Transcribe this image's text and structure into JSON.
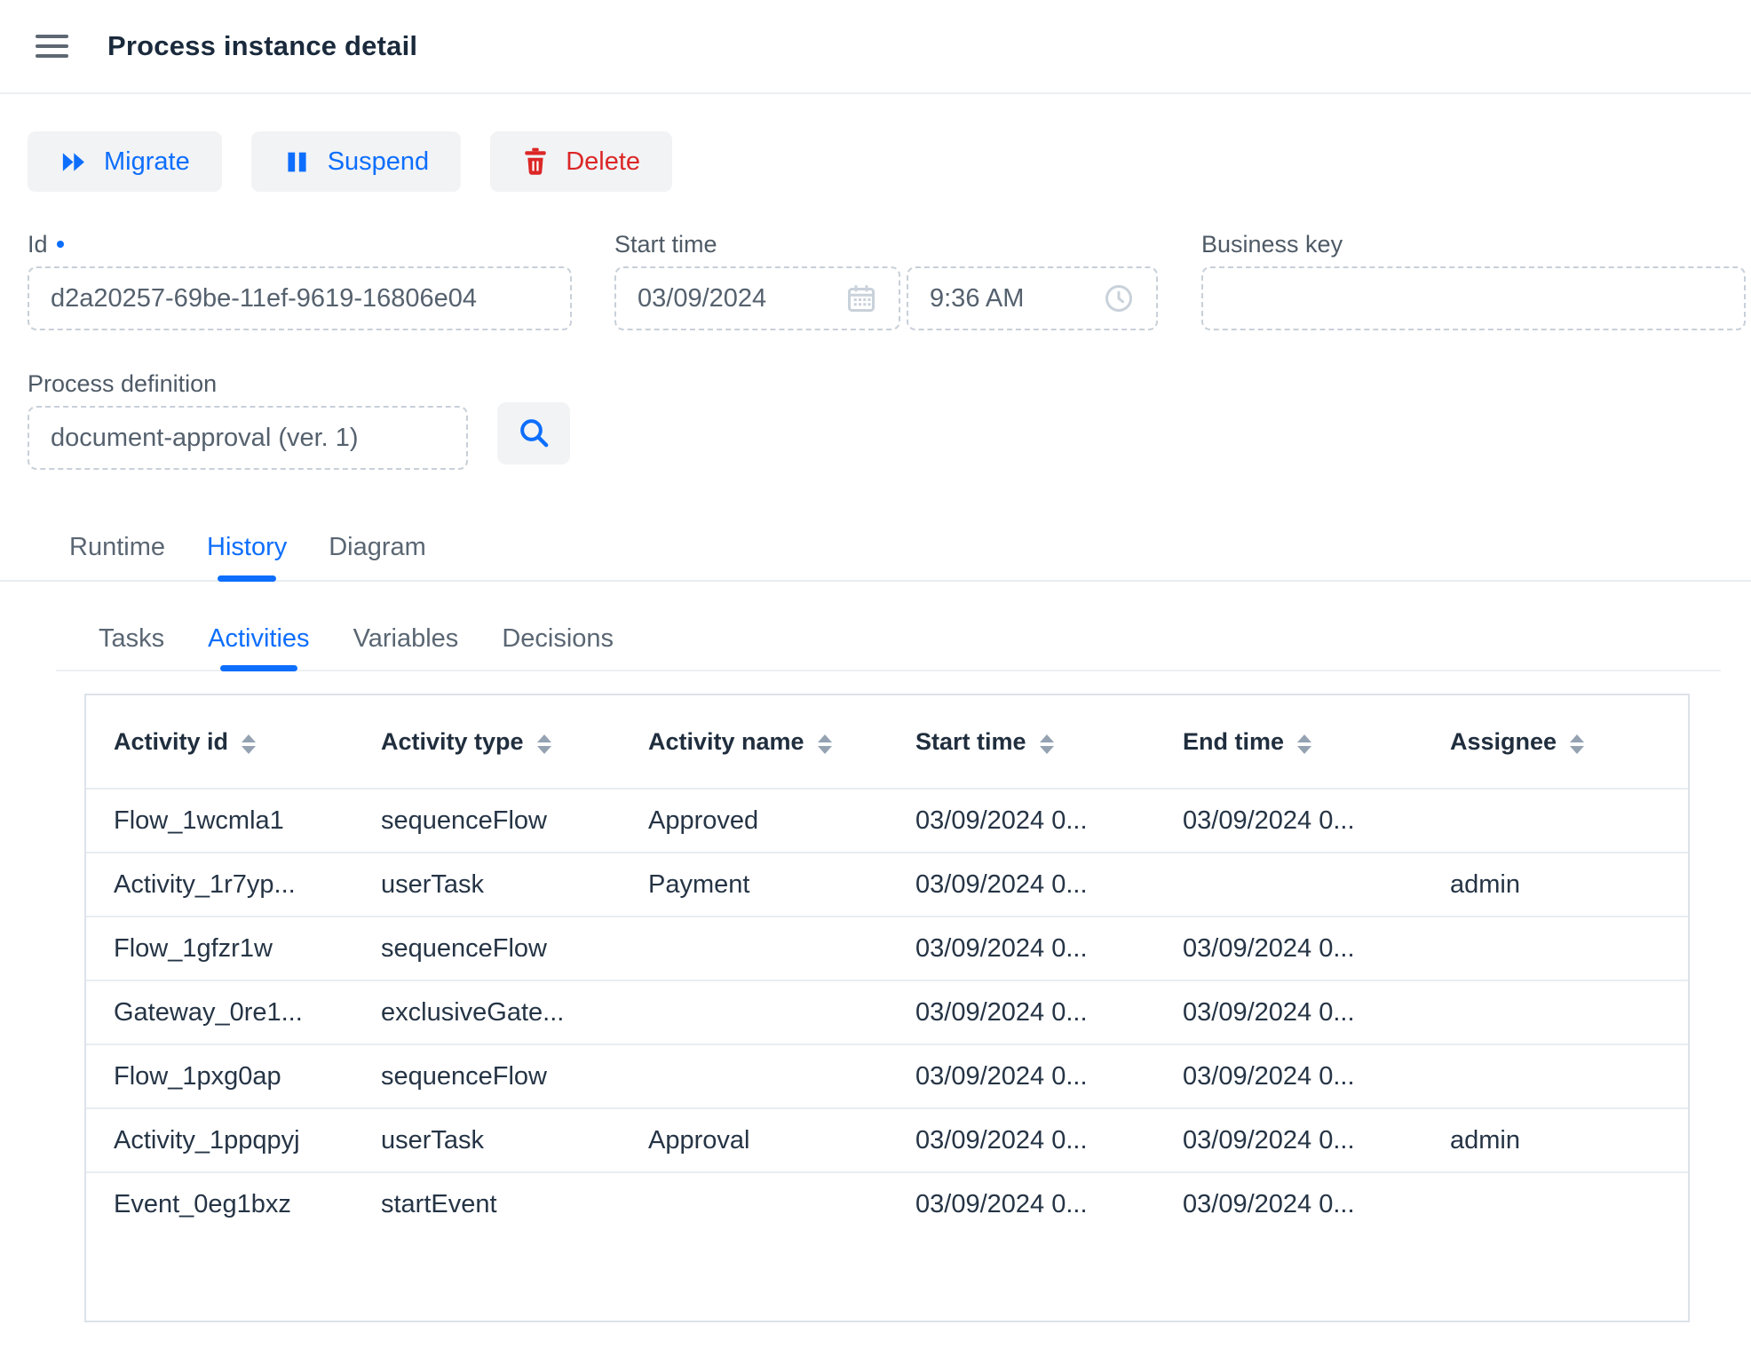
{
  "header": {
    "title": "Process instance detail"
  },
  "actions": {
    "migrate_label": "Migrate",
    "suspend_label": "Suspend",
    "delete_label": "Delete"
  },
  "form": {
    "id": {
      "label": "Id",
      "value": "d2a20257-69be-11ef-9619-16806e04"
    },
    "start_time": {
      "label": "Start time",
      "date_value": "03/09/2024",
      "time_value": "9:36 AM"
    },
    "business_key": {
      "label": "Business key",
      "value": ""
    },
    "process_definition": {
      "label": "Process definition",
      "value": "document-approval (ver. 1)"
    }
  },
  "tabs": {
    "items": [
      {
        "label": "Runtime",
        "active": false
      },
      {
        "label": "History",
        "active": true
      },
      {
        "label": "Diagram",
        "active": false
      }
    ]
  },
  "subtabs": {
    "items": [
      {
        "label": "Tasks",
        "active": false
      },
      {
        "label": "Activities",
        "active": true
      },
      {
        "label": "Variables",
        "active": false
      },
      {
        "label": "Decisions",
        "active": false
      }
    ]
  },
  "table": {
    "columns": [
      {
        "label": "Activity id"
      },
      {
        "label": "Activity type"
      },
      {
        "label": "Activity name"
      },
      {
        "label": "Start time"
      },
      {
        "label": "End time"
      },
      {
        "label": "Assignee"
      }
    ],
    "rows": [
      {
        "activity_id": "Flow_1wcmla1",
        "activity_type": "sequenceFlow",
        "activity_name": "Approved",
        "start_time": "03/09/2024 0...",
        "end_time": "03/09/2024 0...",
        "assignee": ""
      },
      {
        "activity_id": "Activity_1r7yp...",
        "activity_type": "userTask",
        "activity_name": "Payment",
        "start_time": "03/09/2024 0...",
        "end_time": "",
        "assignee": "admin"
      },
      {
        "activity_id": "Flow_1gfzr1w",
        "activity_type": "sequenceFlow",
        "activity_name": "",
        "start_time": "03/09/2024 0...",
        "end_time": "03/09/2024 0...",
        "assignee": ""
      },
      {
        "activity_id": "Gateway_0re1...",
        "activity_type": "exclusiveGate...",
        "activity_name": "",
        "start_time": "03/09/2024 0...",
        "end_time": "03/09/2024 0...",
        "assignee": ""
      },
      {
        "activity_id": "Flow_1pxg0ap",
        "activity_type": "sequenceFlow",
        "activity_name": "",
        "start_time": "03/09/2024 0...",
        "end_time": "03/09/2024 0...",
        "assignee": ""
      },
      {
        "activity_id": "Activity_1ppqpyj",
        "activity_type": "userTask",
        "activity_name": "Approval",
        "start_time": "03/09/2024 0...",
        "end_time": "03/09/2024 0...",
        "assignee": "admin"
      },
      {
        "activity_id": "Event_0eg1bxz",
        "activity_type": "startEvent",
        "activity_name": "",
        "start_time": "03/09/2024 0...",
        "end_time": "03/09/2024 0...",
        "assignee": ""
      }
    ]
  },
  "icons": {
    "hamburger": "menu-icon",
    "migrate": "fast-forward-icon",
    "suspend": "pause-icon",
    "delete": "trash-icon",
    "date": "calendar-icon",
    "time": "clock-icon",
    "search": "search-icon",
    "sort": "sort-arrows-icon"
  },
  "colors": {
    "accent_blue": "#0d6efd",
    "danger_red": "#dc2626",
    "title_text": "#1a2a3c",
    "button_bg": "#f1f3f5",
    "dashed_border": "#c8d0d9",
    "row_separator": "#e8edf2"
  }
}
